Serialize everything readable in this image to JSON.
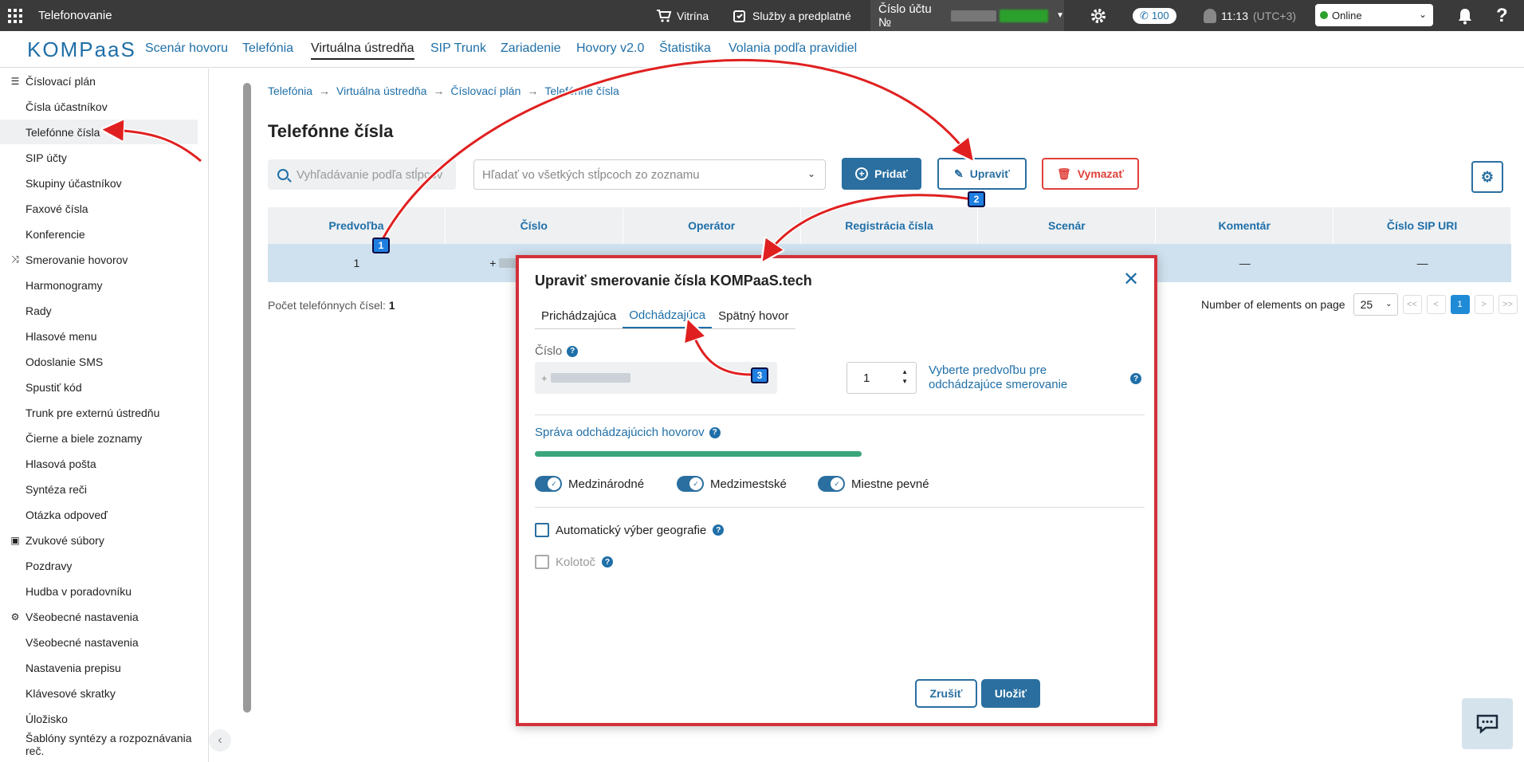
{
  "topbar": {
    "app_title": "Telefonovanie",
    "shop": "Vitrína",
    "services": "Služby a predplatné",
    "account_label": "Číslo účtu №",
    "calls_count": "100",
    "time": "11:13",
    "timezone": "(UTC+3)",
    "status": "Online",
    "status_color": "#2ca02c"
  },
  "nav": {
    "logo": "KOMPaaS",
    "items": [
      "Scenár hovoru",
      "Telefónia",
      "Virtuálna ústredňa",
      "SIP Trunk",
      "Zariadenie",
      "Hovory v2.0",
      "Štatistika",
      "Volania podľa pravidiel"
    ],
    "active": "Virtuálna ústredňa"
  },
  "sidebar": {
    "sections": [
      {
        "title": "Číslovací plán",
        "items": [
          "Čísla účastníkov",
          "Telefónne čísla",
          "SIP účty",
          "Skupiny účastníkov",
          "Faxové čísla",
          "Konferencie"
        ]
      },
      {
        "title": "Smerovanie hovorov",
        "items": [
          "Harmonogramy",
          "Rady",
          "Hlasové menu",
          "Odoslanie SMS",
          "Spustiť kód",
          "Trunk pre externú ústredňu",
          "Čierne a biele zoznamy",
          "Hlasová pošta",
          "Syntéza reči",
          "Otázka odpoveď"
        ]
      },
      {
        "title": "Zvukové súbory",
        "items": [
          "Pozdravy",
          "Hudba v poradovníku"
        ]
      },
      {
        "title": "Všeobecné nastavenia",
        "items": [
          "Všeobecné nastavenia",
          "Nastavenia prepisu",
          "Klávesové skratky",
          "Úložisko",
          "Šablóny syntézy a rozpoznávania reč."
        ]
      }
    ],
    "selected": "Telefónne čísla"
  },
  "breadcrumb": [
    "Telefónia",
    "Virtuálna ústredňa",
    "Číslovací plán",
    "Telefónne čísla"
  ],
  "page_title": "Telefónne čísla",
  "search": {
    "placeholder": "Vyhľadávanie podľa stĺpcov"
  },
  "column_select": {
    "placeholder": "Hľadať vo všetkých stĺpcoch zo zoznamu"
  },
  "actions": {
    "add": "Pridať",
    "edit": "Upraviť",
    "delete": "Vymazať"
  },
  "table": {
    "headers": [
      "Predvoľba",
      "Číslo",
      "Operátor",
      "Registrácia čísla",
      "Scenár",
      "Komentár",
      "Číslo SIP URI"
    ],
    "rows": [
      [
        "1",
        "+",
        "",
        "",
        "",
        "—",
        "—"
      ]
    ]
  },
  "count_label": "Počet telefónnych čísel:",
  "count_value": "1",
  "pager": {
    "label": "Number of elements on page",
    "page_size": "25",
    "first": "<<",
    "prev": "<",
    "current": "1",
    "next": ">",
    "last": ">>"
  },
  "modal": {
    "title": "Upraviť smerovanie čísla KOMPaaS.tech",
    "tabs": [
      "Prichádzajúca",
      "Odchádzajúca",
      "Spätný hovor"
    ],
    "active_tab": "Odchádzajúca",
    "number_label": "Číslo",
    "number_prefix": "+",
    "prefix_value": "1",
    "prefix_hint": "Vyberte predvoľbu pre odchádzajúce smerovanie",
    "section_title": "Správa odchádzajúcich hovorov",
    "progress": 1.0,
    "toggles": [
      {
        "label": "Medzinárodné",
        "on": true
      },
      {
        "label": "Medzimestské",
        "on": true
      },
      {
        "label": "Miestne pevné",
        "on": true
      }
    ],
    "auto_geo": "Automatický výber geografie",
    "carousel": "Kolotoč",
    "cancel": "Zrušiť",
    "save": "Uložiť"
  },
  "callouts": [
    "1",
    "2",
    "3"
  ],
  "colors": {
    "primary": "#2a6fa0",
    "danger": "#e0403a",
    "highlight": "#d3303a",
    "progress": "#3aa57a"
  }
}
